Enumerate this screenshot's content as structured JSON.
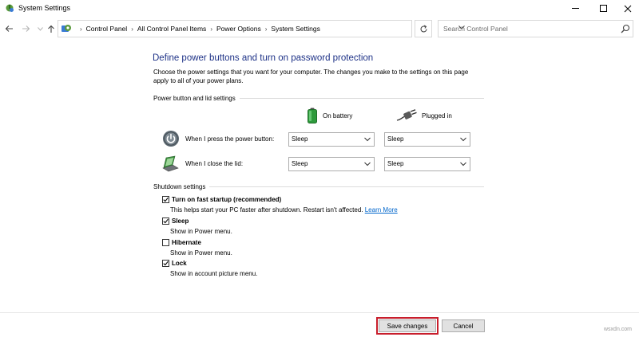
{
  "window": {
    "title": "System Settings"
  },
  "navigation": {
    "breadcrumbs": [
      "Control Panel",
      "All Control Panel Items",
      "Power Options",
      "System Settings"
    ],
    "search_placeholder": "Search Control Panel"
  },
  "page": {
    "heading": "Define power buttons and turn on password protection",
    "description": "Choose the power settings that you want for your computer. The changes you make to the settings on this page apply to all of your power plans."
  },
  "power_section": {
    "title": "Power button and lid settings",
    "columns": [
      {
        "label": "On battery",
        "icon": "battery-icon"
      },
      {
        "label": "Plugged in",
        "icon": "power-plug-icon"
      }
    ],
    "rows": [
      {
        "label": "When I press the power button:",
        "icon": "power-button-icon",
        "on_battery": "Sleep",
        "plugged_in": "Sleep"
      },
      {
        "label": "When I close the lid:",
        "icon": "laptop-lid-icon",
        "on_battery": "Sleep",
        "plugged_in": "Sleep"
      }
    ]
  },
  "shutdown_section": {
    "title": "Shutdown settings",
    "options": [
      {
        "label": "Turn on fast startup (recommended)",
        "checked": true,
        "description": "This helps start your PC faster after shutdown. Restart isn't affected.",
        "link": "Learn More"
      },
      {
        "label": "Sleep",
        "checked": true,
        "description": "Show in Power menu."
      },
      {
        "label": "Hibernate",
        "checked": false,
        "description": "Show in Power menu."
      },
      {
        "label": "Lock",
        "checked": true,
        "description": "Show in account picture menu."
      }
    ]
  },
  "footer": {
    "save_label": "Save changes",
    "cancel_label": "Cancel"
  },
  "watermark": "wsxdn.com",
  "colors": {
    "heading": "#1e3287",
    "link": "#0066cc",
    "highlight": "#c81e2c"
  }
}
